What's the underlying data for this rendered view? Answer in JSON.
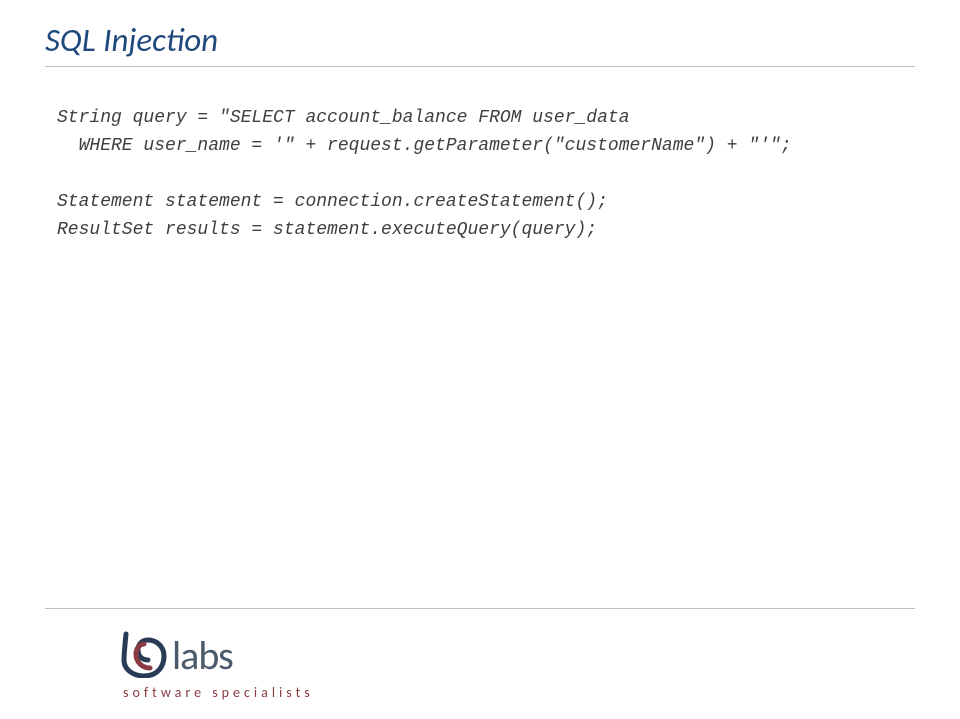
{
  "title": "SQL Injection",
  "code": {
    "l1": "String query = \"SELECT account_balance FROM user_data",
    "l2": "  WHERE user_name = '\" + request.getParameter(\"customerName\") + \"'\";",
    "l3": "",
    "l4": "Statement statement = connection.createStatement();",
    "l5": "ResultSet results = statement.executeQuery(query);"
  },
  "logo": {
    "brand": "labs",
    "tagline": "software  specialists"
  }
}
